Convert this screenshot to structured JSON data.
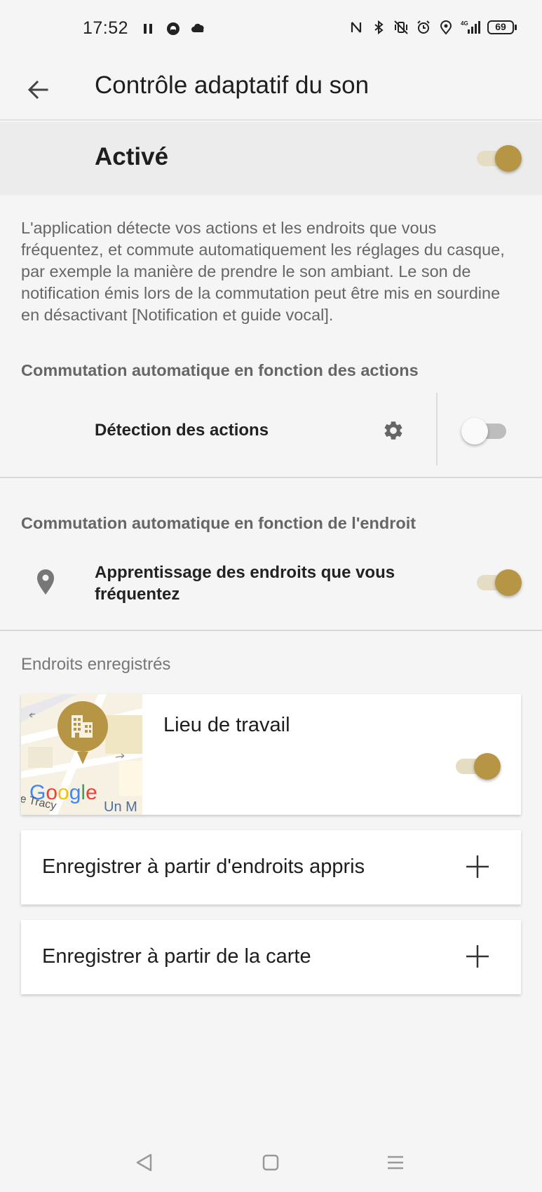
{
  "status_bar": {
    "time": "17:52",
    "left_icons": [
      "pause-icon",
      "app-icon",
      "cloud-icon"
    ],
    "right_icons": [
      "nfc-icon",
      "bluetooth-icon",
      "vibrate-off-icon",
      "alarm-icon",
      "location-icon",
      "signal-4g-icon"
    ],
    "network": "4G",
    "battery": "69"
  },
  "app_bar": {
    "back_icon": "arrow-back-icon",
    "title": "Contrôle adaptatif du son"
  },
  "master": {
    "label": "Activé",
    "enabled": true
  },
  "description": "L'application détecte vos actions et les endroits que vous fréquentez, et commute automatiquement les réglages du casque, par exemple la manière de prendre le son ambiant. Le son de notification émis lors de la commutation peut être mis en sourdine en désactivant [Notification et guide vocal].",
  "actions_section": {
    "header": "Commutation automatique en fonction des actions",
    "row_label": "Détection des actions",
    "settings_icon": "gear-icon",
    "enabled": false
  },
  "location_section": {
    "header": "Commutation automatique en fonction de l'endroit",
    "icon": "location-pin-icon",
    "row_label_line1": "Apprentissage des endroits que vous",
    "row_label_line2": "fréquentez",
    "enabled": true
  },
  "saved_places": {
    "header": "Endroits enregistrés",
    "places": [
      {
        "name": "Lieu de travail",
        "icon": "building-icon",
        "enabled": true,
        "map_brand": "Google",
        "map_street_1": "e Tracy",
        "map_street_2": "Un M"
      }
    ],
    "add_from_learned": "Enregistrer à partir d'endroits appris",
    "add_from_map": "Enregistrer à partir de la carte"
  },
  "nav_bar": {
    "back": "nav-back-icon",
    "home": "nav-home-icon",
    "recents": "nav-menu-icon"
  },
  "colors": {
    "accent": "#b69545",
    "accent_track": "#e5dcc4",
    "background": "#f5f5f5",
    "master_row_bg": "#ececec"
  }
}
